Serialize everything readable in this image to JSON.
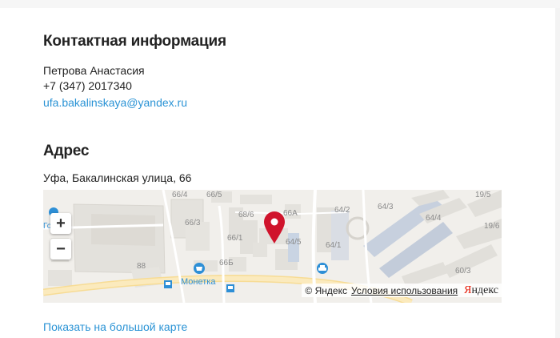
{
  "contacts": {
    "title": "Контактная информация",
    "name": "Петрова Анастасия",
    "phone": "+7 (347) 2017340",
    "email": "ufa.bakalinskaya@yandex.ru"
  },
  "address": {
    "title": "Адрес",
    "text": "Уфа, Бакалинская улица, 66"
  },
  "map": {
    "zoom_in": "+",
    "zoom_out": "−",
    "labels": {
      "b66_4": "66/4",
      "b66_5": "66/5",
      "b66_3": "66/3",
      "b68_6": "68/6",
      "b66A": "66А",
      "b64_2": "64/2",
      "b64_3": "64/3",
      "b64_4": "64/4",
      "b19_5": "19/5",
      "b19_6": "19/6",
      "b66_1": "66/1",
      "b64_5": "64/5",
      "b64_1": "64/1",
      "b88": "88",
      "b66B": "66Б",
      "b60_3": "60/3",
      "shop": "Монетка",
      "partial": "Го"
    },
    "copyright": "© Яндекс",
    "terms": "Условия использования",
    "logo_first": "Я",
    "logo_rest": "ндекс"
  },
  "show_large_map": "Показать на большой карте",
  "colors": {
    "link": "#2a93d5",
    "marker": "#d0142c",
    "poi_blue": "#2e8fd6",
    "road": "#f9e3a6"
  }
}
